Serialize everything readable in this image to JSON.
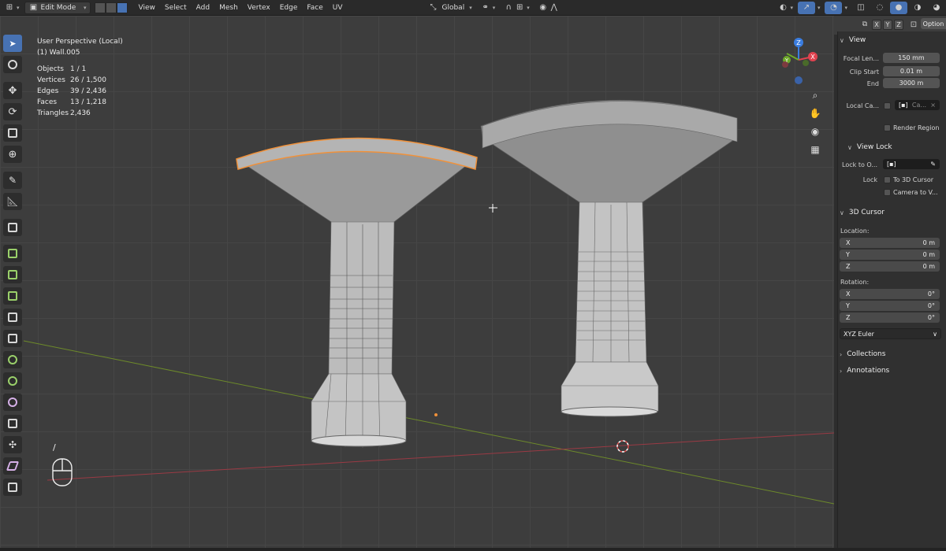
{
  "header": {
    "mode_label": "Edit Mode",
    "menus": [
      "View",
      "Select",
      "Add",
      "Mesh",
      "Vertex",
      "Edge",
      "Face",
      "UV"
    ],
    "orientation_label": "Global"
  },
  "overlay": {
    "view_name": "User Perspective (Local)",
    "object_name": "(1) Wall.005"
  },
  "stats": [
    {
      "label": "Objects",
      "value": "1 / 1"
    },
    {
      "label": "Vertices",
      "value": "26 / 1,500"
    },
    {
      "label": "Edges",
      "value": "39 / 2,436"
    },
    {
      "label": "Faces",
      "value": "13 / 1,218"
    },
    {
      "label": "Triangles",
      "value": "2,436"
    }
  ],
  "sidebar": {
    "axis_buttons": [
      "X",
      "Y",
      "Z"
    ],
    "options_label": "Option",
    "view_panel": {
      "title": "View",
      "focal_length_label": "Focal Len...",
      "focal_length_value": "150 mm",
      "clip_start_label": "Clip Start",
      "clip_start_value": "0.01 m",
      "end_label": "End",
      "end_value": "3000 m",
      "local_camera_label": "Local Ca...",
      "local_camera_value": "Ca...",
      "render_region_label": "Render Region"
    },
    "view_lock": {
      "title": "View Lock",
      "lock_to_object_label": "Lock to O...",
      "lock_label": "Lock",
      "to_3d_cursor_label": "To 3D Cursor",
      "camera_to_view_label": "Camera to V..."
    },
    "cursor_panel": {
      "title": "3D Cursor",
      "location_label": "Location:",
      "location": [
        {
          "axis": "X",
          "value": "0 m"
        },
        {
          "axis": "Y",
          "value": "0 m"
        },
        {
          "axis": "Z",
          "value": "0 m"
        }
      ],
      "rotation_label": "Rotation:",
      "rotation": [
        {
          "axis": "X",
          "value": "0°"
        },
        {
          "axis": "Y",
          "value": "0°"
        },
        {
          "axis": "Z",
          "value": "0°"
        }
      ],
      "rotation_mode": "XYZ Euler"
    },
    "collections_label": "Collections",
    "annotations_label": "Annotations"
  },
  "gizmo": {
    "x_axis": "X",
    "y_axis": "Y",
    "z_axis": "Z",
    "x_color": "#e0424f",
    "y_color": "#6ea82a",
    "z_color": "#3a7de0"
  },
  "colors": {
    "accent": "#4772b3",
    "selection": "#f0913a"
  },
  "mouse_hint": "/"
}
